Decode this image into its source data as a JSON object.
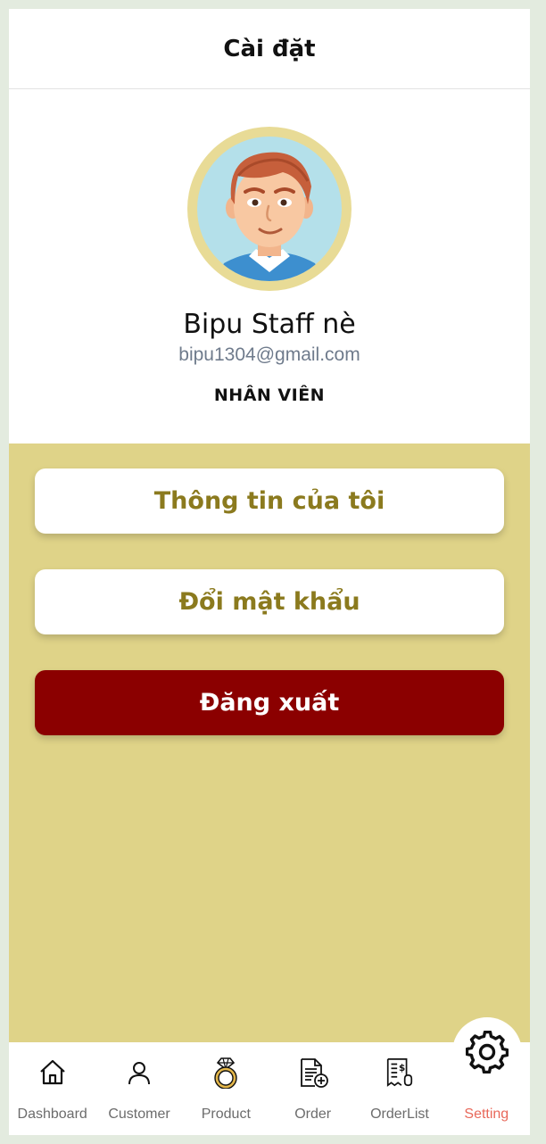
{
  "header": {
    "title": "Cài đặt"
  },
  "profile": {
    "name": "Bipu Staff nè",
    "email": "bipu1304@gmail.com",
    "role": "NHÂN VIÊN"
  },
  "menu": {
    "info_label": "Thông tin của tôi",
    "password_label": "Đổi mật khẩu",
    "logout_label": "Đăng xuất"
  },
  "nav": {
    "items": [
      {
        "label": "Dashboard",
        "icon": "home-icon"
      },
      {
        "label": "Customer",
        "icon": "user-icon"
      },
      {
        "label": "Product",
        "icon": "ring-icon"
      },
      {
        "label": "Order",
        "icon": "order-add-icon"
      },
      {
        "label": "OrderList",
        "icon": "receipt-icon"
      },
      {
        "label": "Setting",
        "icon": "gear-icon",
        "active": true
      }
    ]
  },
  "colors": {
    "accent": "#dfd388",
    "accent_text": "#8b7a1e",
    "logout": "#8b0000",
    "active_nav": "#e8685a"
  }
}
